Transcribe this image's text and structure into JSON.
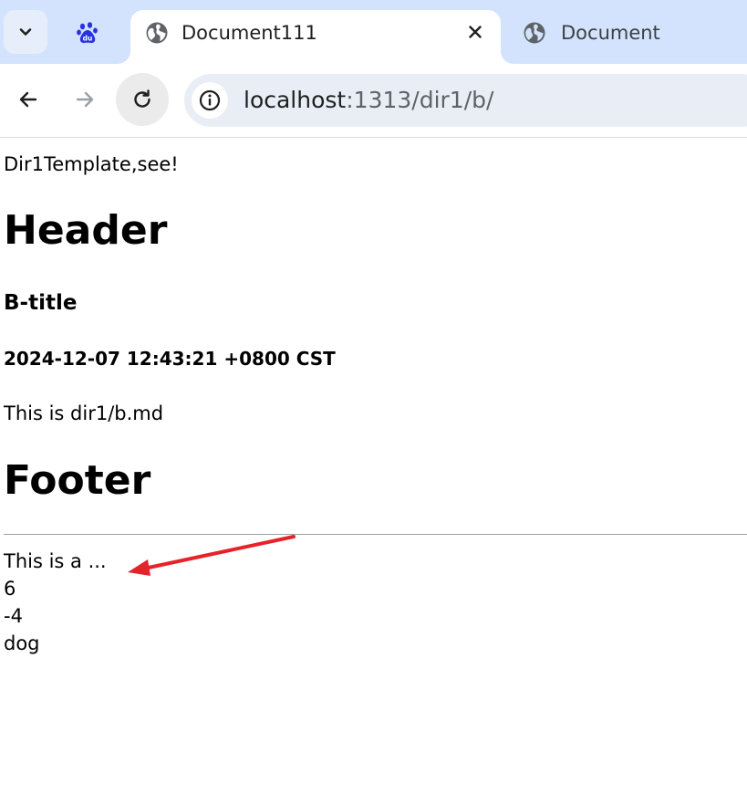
{
  "browser": {
    "tabs": [
      {
        "title": "Document111",
        "favicon": "globe-icon",
        "active": true
      },
      {
        "title": "Document",
        "favicon": "globe-icon",
        "active": false
      }
    ],
    "pinned_tab_icon": "baidu-paw-icon",
    "close_tab_icon": "close-icon",
    "nav": {
      "back_icon": "back-arrow-icon",
      "forward_icon": "forward-arrow-icon",
      "reload_icon": "reload-icon"
    },
    "address": {
      "host": "localhost",
      "rest": ":1313/dir1/b/",
      "site_info_icon": "info-icon"
    }
  },
  "page": {
    "intro": "Dir1Template,see!",
    "header": "Header",
    "title": "B-title",
    "date": "2024-12-07 12:43:21 +0800 CST",
    "body": "This is dir1/b.md",
    "footer": "Footer",
    "footer_lines": [
      "This is a ...",
      "6",
      "-4",
      "dog"
    ]
  },
  "annotation": {
    "arrow_color": "#e5232b"
  }
}
